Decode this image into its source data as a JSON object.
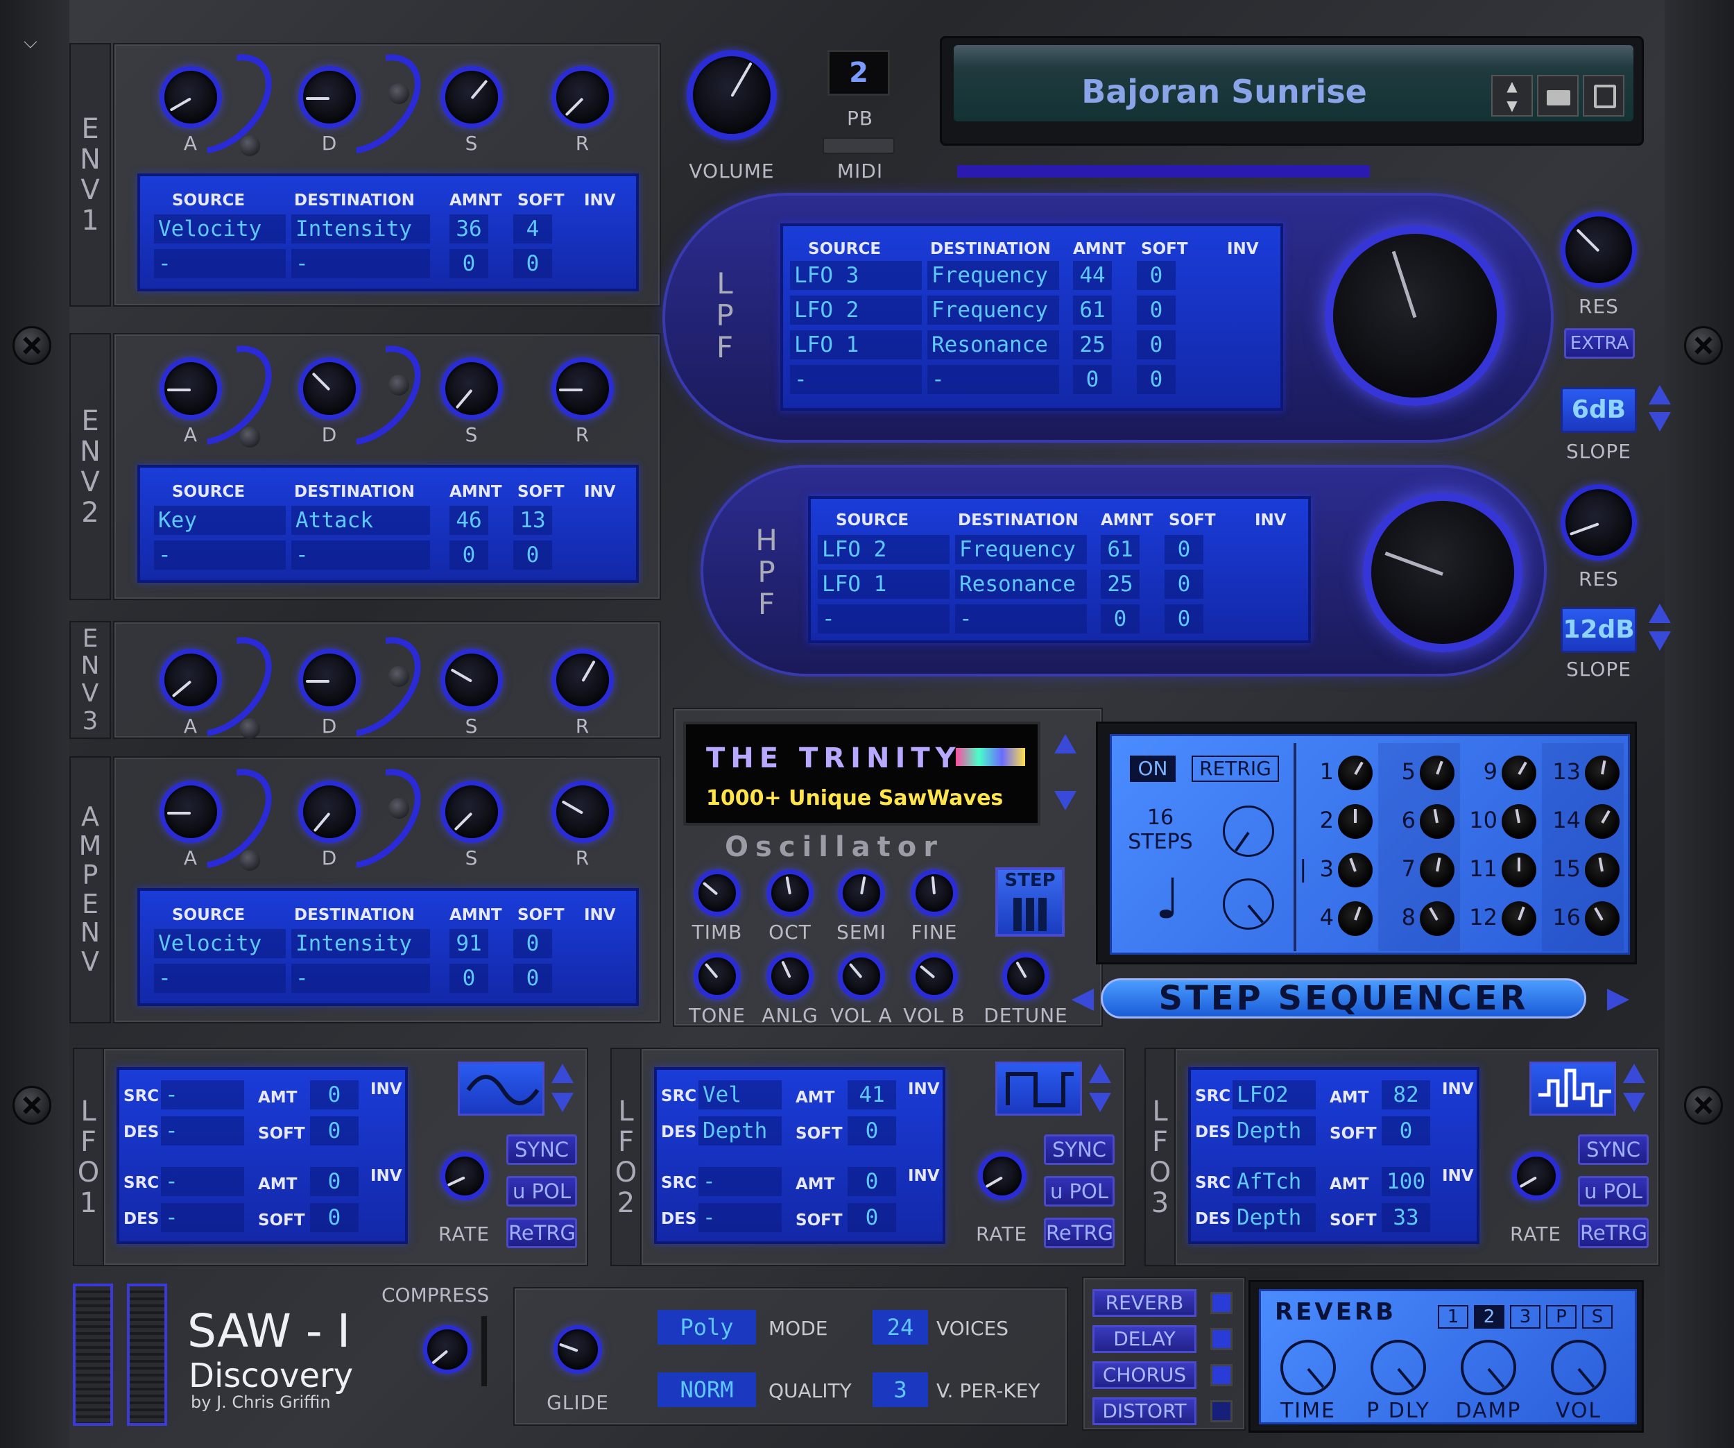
{
  "preset": {
    "name": "Bajoran Sunrise",
    "pb_value": "2",
    "pb_label": "PB",
    "midi_label": "MIDI",
    "volume_label": "VOLUME"
  },
  "knob_labels": {
    "a": "A",
    "d": "D",
    "s": "S",
    "r": "R"
  },
  "env_sections": [
    {
      "label": [
        "E",
        "N",
        "V",
        "1"
      ]
    },
    {
      "label": [
        "E",
        "N",
        "V",
        "2"
      ]
    },
    {
      "label": [
        "E",
        "N",
        "V",
        "3"
      ]
    },
    {
      "label": [
        "A",
        "M",
        "P",
        "E",
        "N",
        "V"
      ]
    }
  ],
  "mod_headers": {
    "source": "SOURCE",
    "destination": "DESTINATION",
    "amnt": "AMNT",
    "soft": "SOFT",
    "inv": "INV"
  },
  "env1_mod": [
    {
      "src": "Velocity",
      "dest": "Intensity",
      "amnt": "36",
      "soft": "4"
    },
    {
      "src": "-",
      "dest": "-",
      "amnt": "0",
      "soft": "0"
    }
  ],
  "env2_mod": [
    {
      "src": "Key",
      "dest": "Attack",
      "amnt": "46",
      "soft": "13"
    },
    {
      "src": "-",
      "dest": "-",
      "amnt": "0",
      "soft": "0"
    }
  ],
  "ampenv_mod": [
    {
      "src": "Velocity",
      "dest": "Intensity",
      "amnt": "91",
      "soft": "0"
    },
    {
      "src": "-",
      "dest": "-",
      "amnt": "0",
      "soft": "0"
    }
  ],
  "lpf": {
    "label": [
      "L",
      "P",
      "F"
    ],
    "rows": [
      {
        "src": "LFO 3",
        "dest": "Frequency",
        "amnt": "44",
        "soft": "0"
      },
      {
        "src": "LFO 2",
        "dest": "Frequency",
        "amnt": "61",
        "soft": "0"
      },
      {
        "src": "LFO 1",
        "dest": "Resonance",
        "amnt": "25",
        "soft": "0"
      },
      {
        "src": "-",
        "dest": "-",
        "amnt": "0",
        "soft": "0"
      }
    ],
    "res_label": "RES",
    "extra_label": "EXTRA",
    "slope_value": "6dB",
    "slope_label": "SLOPE"
  },
  "hpf": {
    "label": [
      "H",
      "P",
      "F"
    ],
    "rows": [
      {
        "src": "LFO 2",
        "dest": "Frequency",
        "amnt": "61",
        "soft": "0"
      },
      {
        "src": "LFO 1",
        "dest": "Resonance",
        "amnt": "25",
        "soft": "0"
      },
      {
        "src": "-",
        "dest": "-",
        "amnt": "0",
        "soft": "0"
      }
    ],
    "res_label": "RES",
    "slope_value": "12dB",
    "slope_label": "SLOPE"
  },
  "oscillator": {
    "title": "Oscillator",
    "display_line1": "THE TRINITY",
    "display_line2": "1000+ Unique SawWaves",
    "knobs_row1": [
      "TIMB",
      "OCT",
      "SEMI",
      "FINE"
    ],
    "knobs_row2": [
      "TONE",
      "ANLG",
      "VOL A",
      "VOL B",
      "DETUNE"
    ],
    "step_label": "STEP"
  },
  "sequencer": {
    "on_label": "ON",
    "retrig_label": "RETRIG",
    "steps_count": "16",
    "steps_label": "STEPS",
    "note_glyph": "♩",
    "step_numbers": [
      "1",
      "2",
      "3",
      "4",
      "5",
      "6",
      "7",
      "8",
      "9",
      "10",
      "11",
      "12",
      "13",
      "14",
      "15",
      "16"
    ],
    "current_marker": "|",
    "title": "STEP SEQUENCER"
  },
  "lfos": [
    {
      "label": [
        "L",
        "F",
        "O",
        "1"
      ],
      "rows": [
        {
          "src": "-",
          "amt": "0",
          "des": "-",
          "soft": "0"
        },
        {
          "src": "-",
          "amt": "0",
          "des": "-",
          "soft": "0"
        }
      ],
      "wave": "sine"
    },
    {
      "label": [
        "L",
        "F",
        "O",
        "2"
      ],
      "rows": [
        {
          "src": "Vel",
          "amt": "41",
          "des": "Depth",
          "soft": "0"
        },
        {
          "src": "-",
          "amt": "0",
          "des": "-",
          "soft": "0"
        }
      ],
      "wave": "square"
    },
    {
      "label": [
        "L",
        "F",
        "O",
        "3"
      ],
      "rows": [
        {
          "src": "LFO2",
          "amt": "82",
          "des": "Depth",
          "soft": "0"
        },
        {
          "src": "AfTch",
          "amt": "100",
          "des": "Depth",
          "soft": "33"
        }
      ],
      "wave": "random"
    }
  ],
  "lfo_labels": {
    "src": "SRC",
    "des": "DES",
    "amt": "AMT",
    "soft": "SOFT",
    "inv": "INV",
    "rate": "RATE",
    "sync": "SYNC",
    "upol": "u POL",
    "retrg": "ReTRG"
  },
  "footer": {
    "product": "SAW - I",
    "edition": "Discovery",
    "author": "by J. Chris Griffin",
    "compress_label": "COMPRESS",
    "glide_label": "GLIDE",
    "mode_value": "Poly",
    "mode_label": "MODE",
    "voices_value": "24",
    "voices_label": "VOICES",
    "quality_value": "NORM",
    "quality_label": "QUALITY",
    "vperkey_value": "3",
    "vperkey_label": "V. PER-KEY"
  },
  "fx": {
    "buttons": [
      "REVERB",
      "DELAY",
      "CHORUS",
      "DISTORT"
    ],
    "panel_title": "REVERB",
    "presets": [
      "1",
      "2",
      "3",
      "P",
      "S"
    ],
    "knobs": [
      "TIME",
      "P DLY",
      "DAMP",
      "VOL"
    ]
  },
  "colors": {
    "accent": "#2a2ad8",
    "lcd": "#1a3cd8",
    "lcd_text": "#5ec8ff",
    "seq_bg": "#3a7cf0"
  }
}
